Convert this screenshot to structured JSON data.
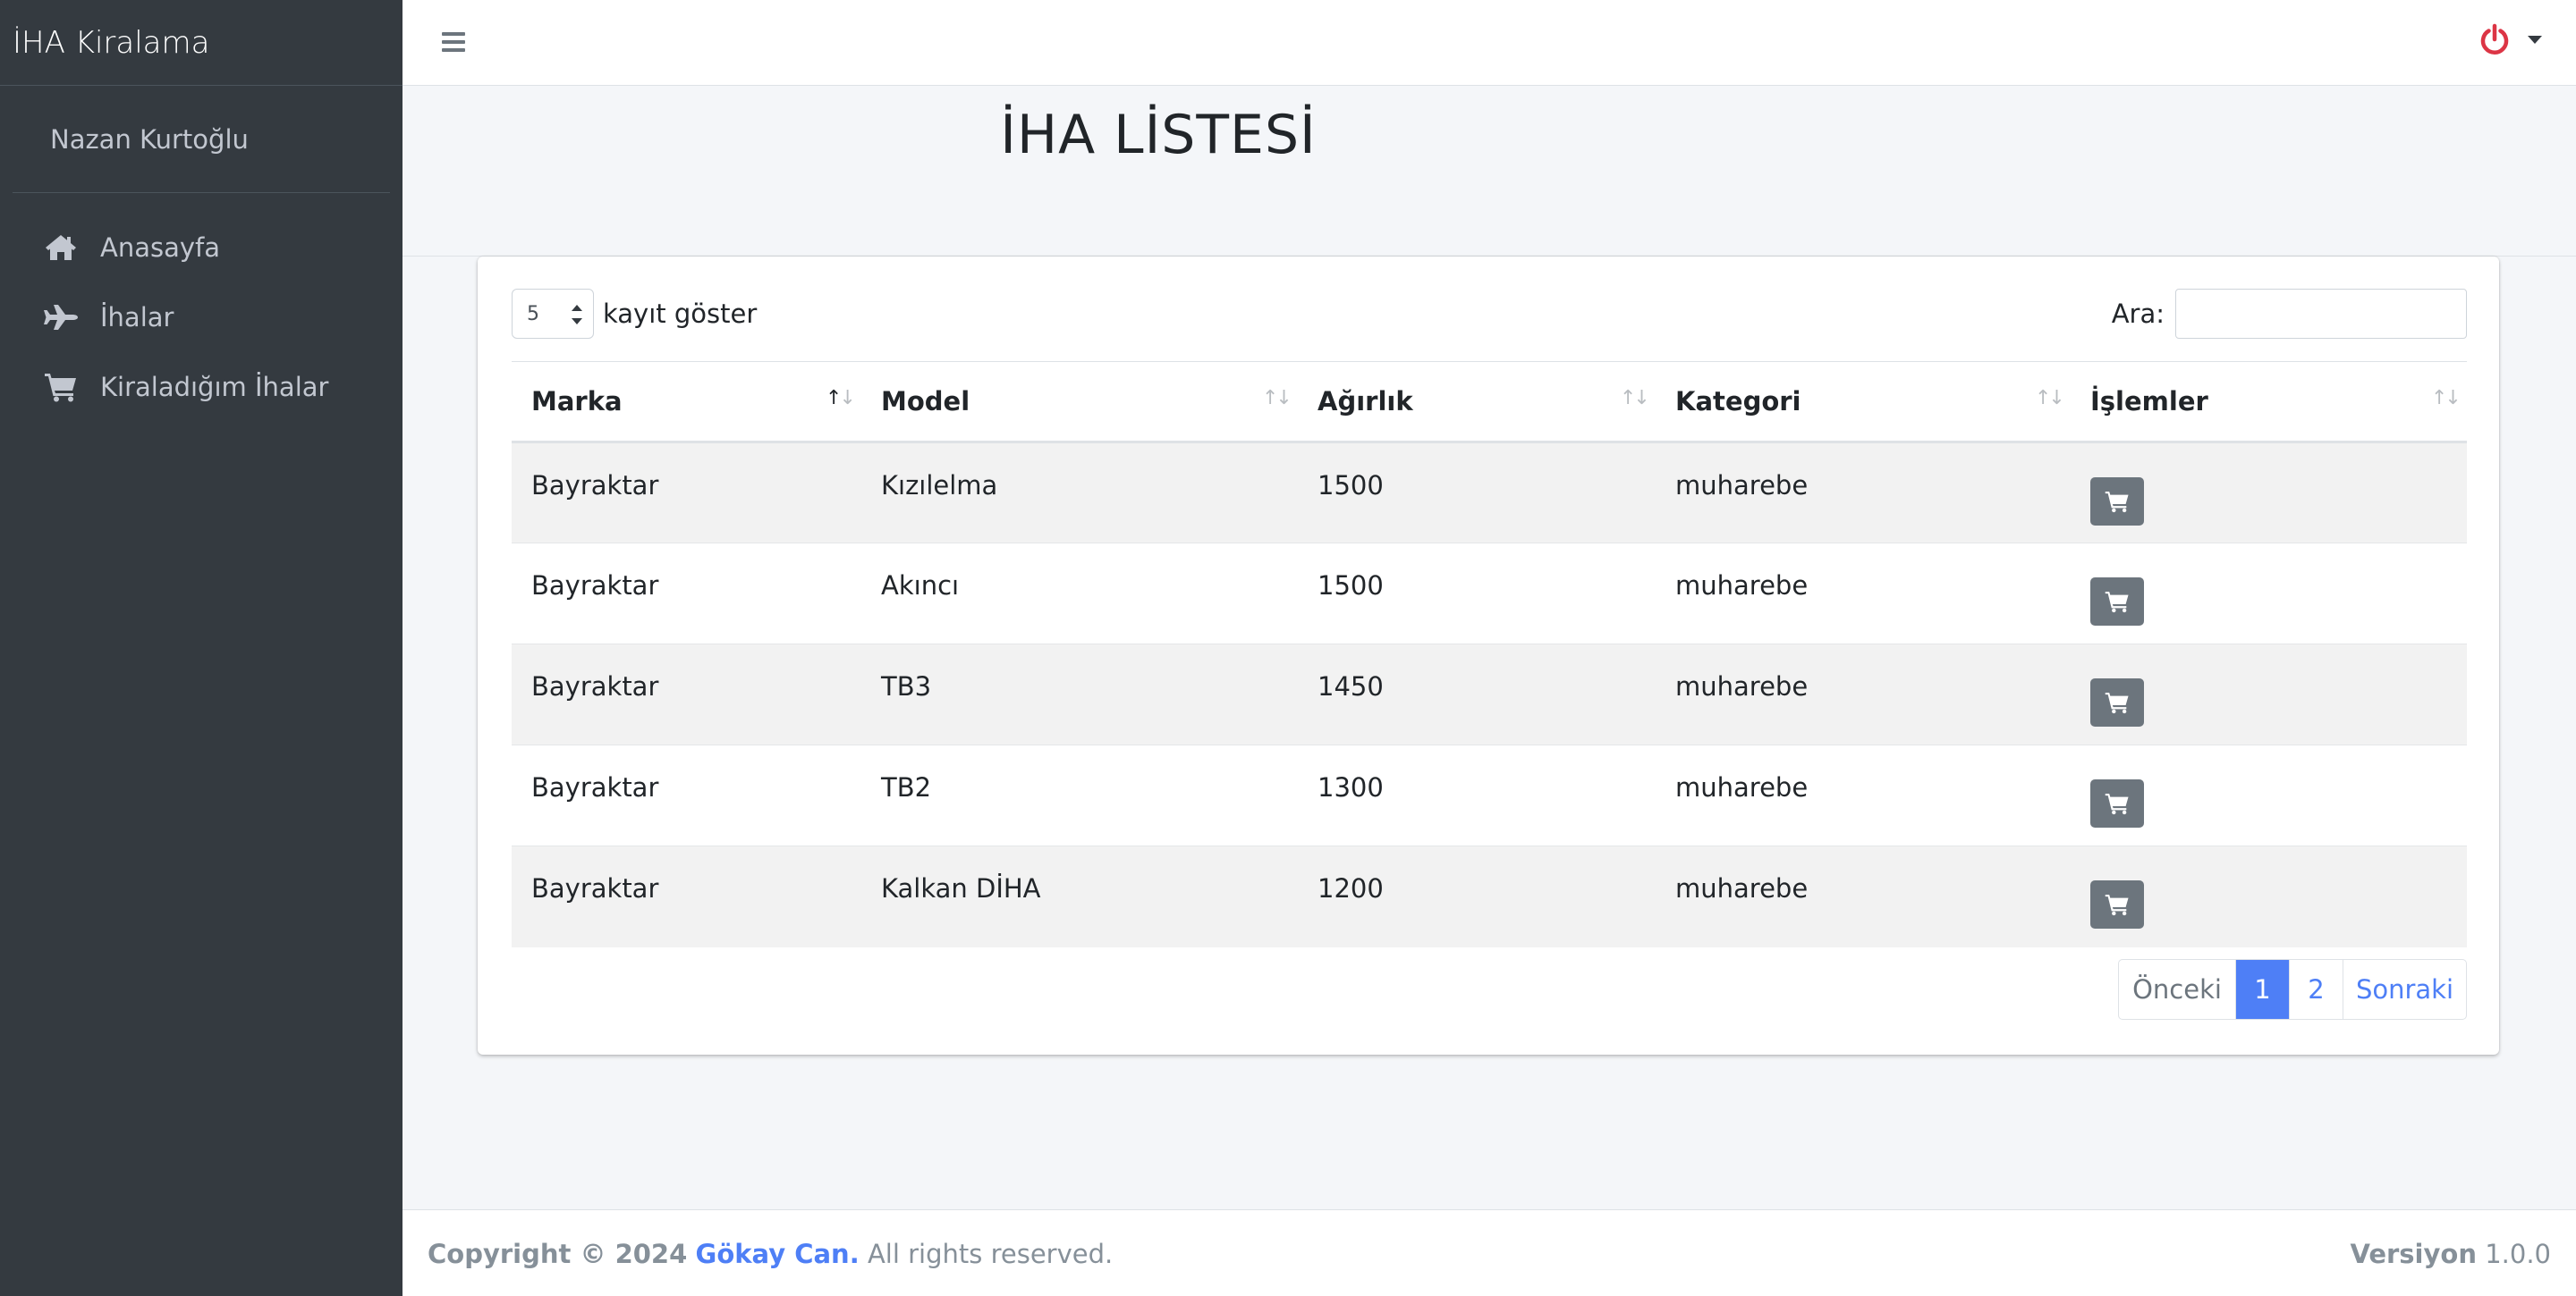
{
  "app": {
    "brand": "İHA Kiralama"
  },
  "sidebar": {
    "user_name": "Nazan Kurtoğlu",
    "items": [
      {
        "label": "Anasayfa",
        "icon": "home-icon"
      },
      {
        "label": "İhalar",
        "icon": "plane-icon"
      },
      {
        "label": "Kiraladığım İhalar",
        "icon": "cart-icon"
      }
    ]
  },
  "topbar": {
    "menu_icon": "hamburger-icon",
    "user_menu_icon": "power-icon",
    "power_color": "#dc3545"
  },
  "page": {
    "title": "İHA LİSTESİ"
  },
  "table_controls": {
    "length_value": "5",
    "length_label": "kayıt göster",
    "search_label": "Ara:",
    "search_value": ""
  },
  "table": {
    "columns": [
      "Marka",
      "Model",
      "Ağırlık",
      "Kategori",
      "İşlemler"
    ],
    "sorted_column": "Marka",
    "rows": [
      {
        "marka": "Bayraktar",
        "model": "Kızılelma",
        "agirlik": "1500",
        "kategori": "muharebe"
      },
      {
        "marka": "Bayraktar",
        "model": "Akıncı",
        "agirlik": "1500",
        "kategori": "muharebe"
      },
      {
        "marka": "Bayraktar",
        "model": "TB3",
        "agirlik": "1450",
        "kategori": "muharebe"
      },
      {
        "marka": "Bayraktar",
        "model": "TB2",
        "agirlik": "1300",
        "kategori": "muharebe"
      },
      {
        "marka": "Bayraktar",
        "model": "Kalkan DİHA",
        "agirlik": "1200",
        "kategori": "muharebe"
      }
    ],
    "action_icon": "cart-icon"
  },
  "pagination": {
    "prev": "Önceki",
    "pages": [
      "1",
      "2"
    ],
    "current": "1",
    "next": "Sonraki",
    "accent": "#4e7ff6"
  },
  "footer": {
    "copyright_prefix": "Copyright © 2024",
    "author": "Gökay Can.",
    "rights": "All rights reserved.",
    "version_label": "Versiyon",
    "version_value": "1.0.0"
  }
}
